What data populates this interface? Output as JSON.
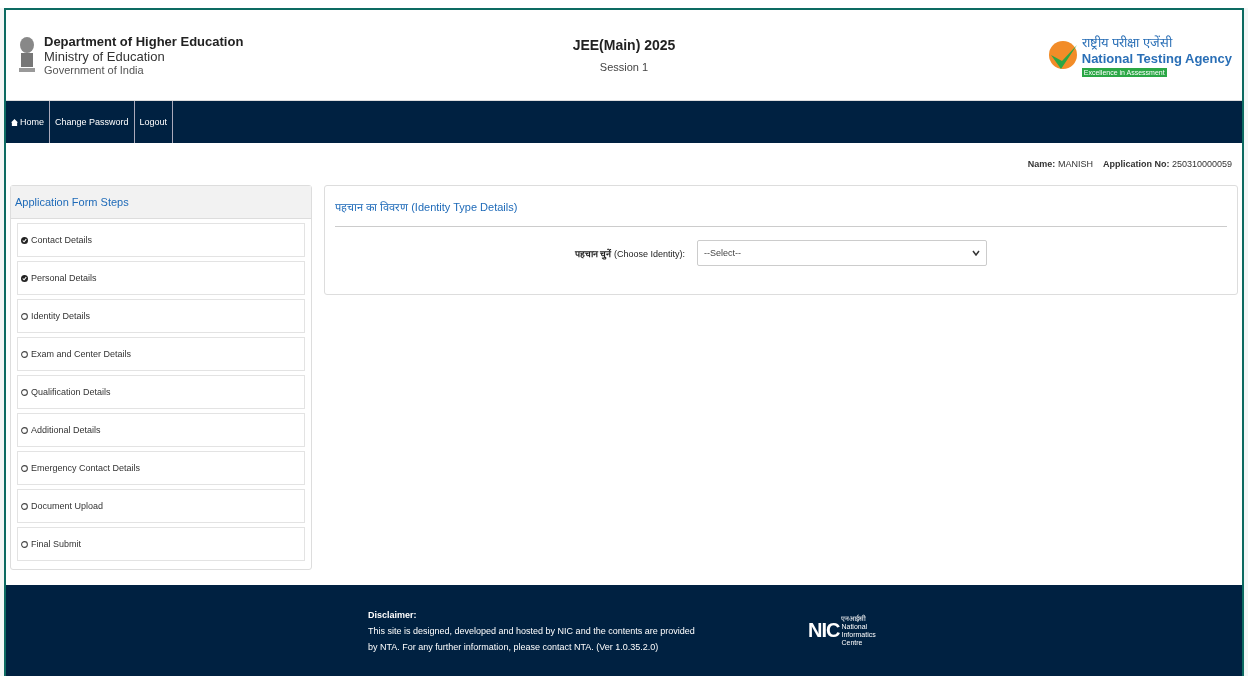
{
  "header": {
    "dept": "Department of Higher Education",
    "ministry": "Ministry of Education",
    "government": "Government of India",
    "exam_title": "JEE(Main) 2025",
    "session": "Session 1",
    "agency_hindi": "राष्ट्रीय परीक्षा एजेंसी",
    "agency": "National Testing Agency",
    "agency_tagline": "Excellence in Assessment"
  },
  "nav": [
    {
      "label": "Home"
    },
    {
      "label": "Change Password"
    },
    {
      "label": "Logout"
    }
  ],
  "user": {
    "name_label": "Name:",
    "name": "MANISH",
    "app_label": "Application No:",
    "app_no": "250310000059"
  },
  "sidebar": {
    "title": "Application Form Steps",
    "steps": [
      {
        "label": "Contact Details",
        "completed": true
      },
      {
        "label": "Personal Details",
        "completed": true
      },
      {
        "label": "Identity Details",
        "completed": false
      },
      {
        "label": "Exam and Center Details",
        "completed": false
      },
      {
        "label": "Qualification Details",
        "completed": false
      },
      {
        "label": "Additional Details",
        "completed": false
      },
      {
        "label": "Emergency Contact Details",
        "completed": false
      },
      {
        "label": "Document Upload",
        "completed": false
      },
      {
        "label": "Final Submit",
        "completed": false
      }
    ]
  },
  "panel": {
    "title_hindi": "पहचान का विवरण",
    "title": "(Identity Type Details)",
    "field_label_hindi": "पहचान चुनें",
    "field_label": "(Choose Identity):",
    "field_value": "--Select--"
  },
  "footer": {
    "heading": "Disclaimer:",
    "text": "This site is designed, developed and hosted by NIC and the contents are provided by NTA. For any further information, please contact NTA. (Ver 1.0.35.2.0)",
    "nic": "NIC",
    "nic_lines": [
      "एनआईसी",
      "National",
      "Informatics",
      "Centre"
    ]
  }
}
